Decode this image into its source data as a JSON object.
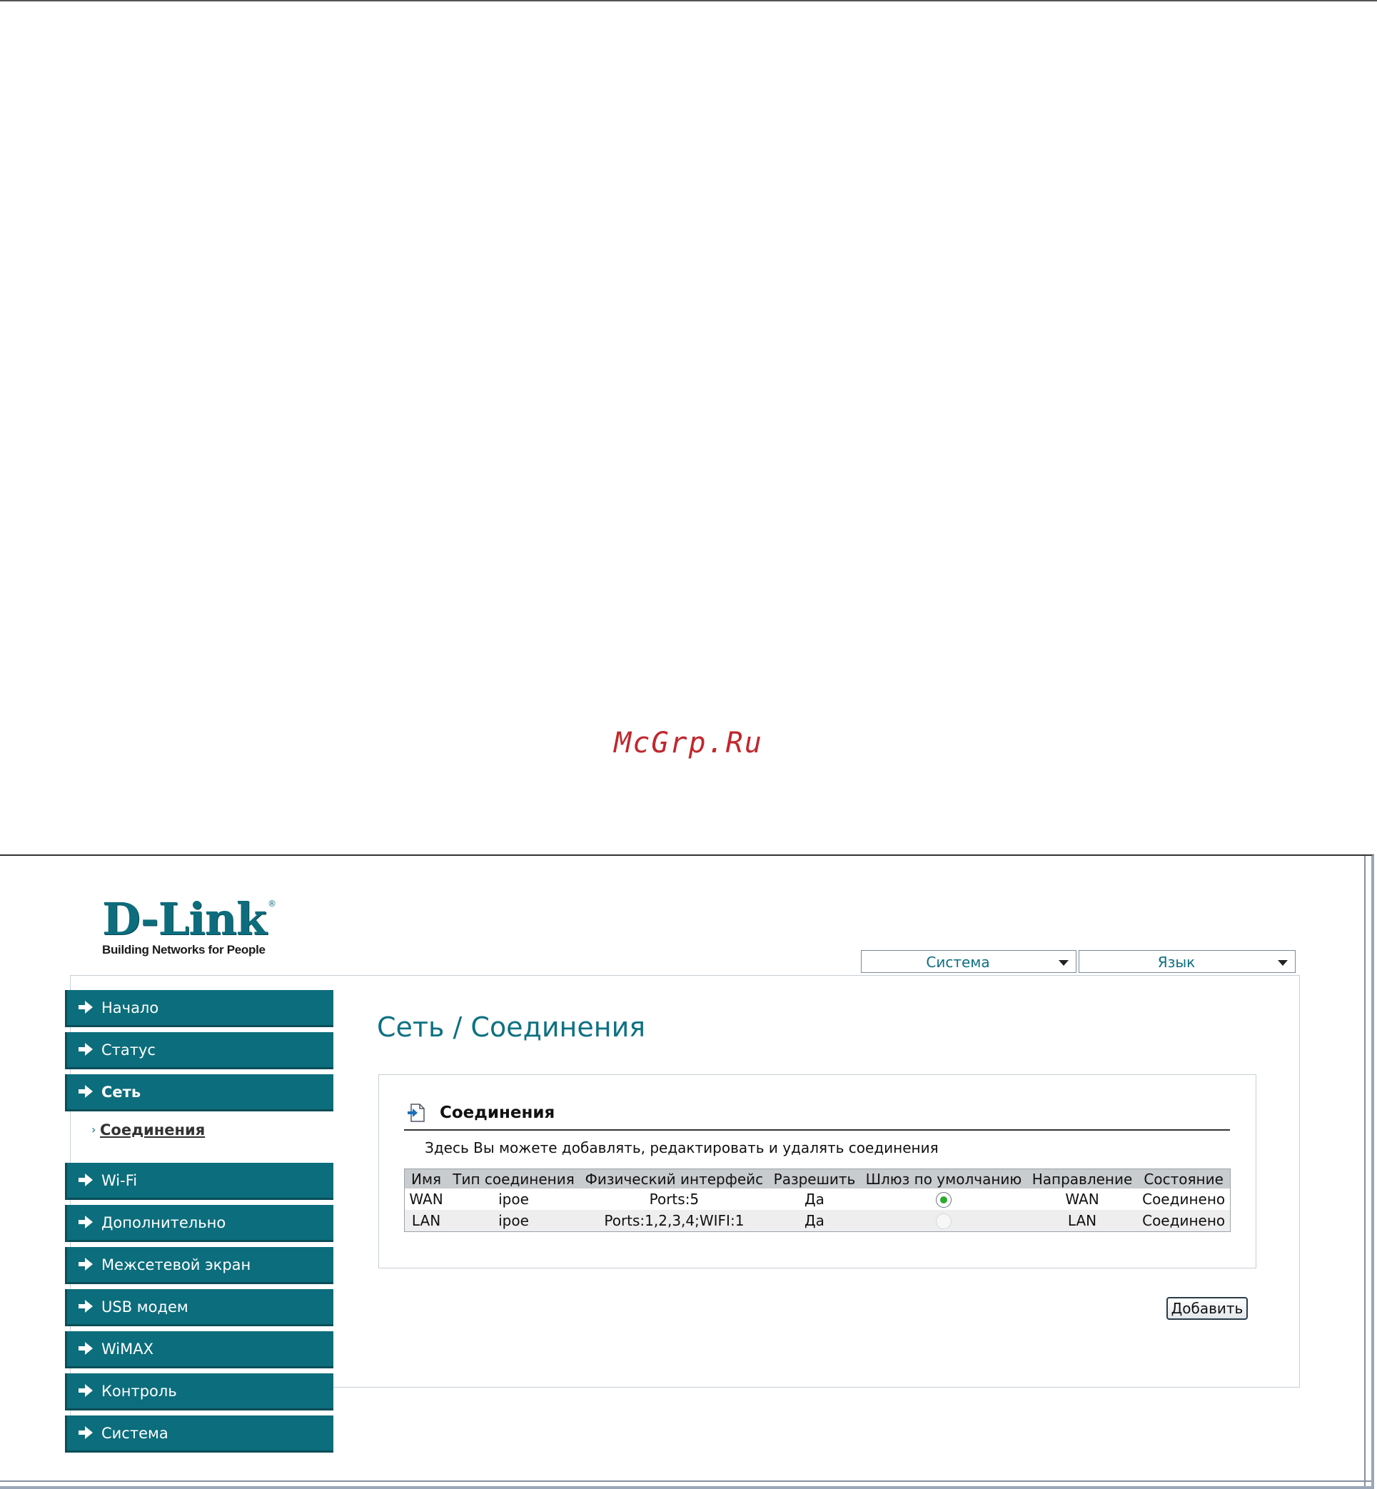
{
  "watermark": "McGrp.Ru",
  "logo": {
    "brand": "D-Link",
    "registered": "®",
    "tagline": "Building Networks for People"
  },
  "top_menus": [
    {
      "label": "Система"
    },
    {
      "label": "Язык"
    }
  ],
  "sidebar": {
    "items": [
      {
        "label": "Начало"
      },
      {
        "label": "Статус"
      },
      {
        "label": "Сеть"
      },
      {
        "label": "Wi-Fi"
      },
      {
        "label": "Дополнительно"
      },
      {
        "label": "Межсетевой экран"
      },
      {
        "label": "USB модем"
      },
      {
        "label": "WiMAX"
      },
      {
        "label": "Контроль"
      },
      {
        "label": "Система"
      }
    ],
    "active": "Сеть",
    "sub_item": {
      "label": "Соединения",
      "bullet": "›"
    }
  },
  "page_title": "Сеть  / Соединения",
  "connections": {
    "title": "Соединения",
    "description": "Здесь Вы можете добавлять, редактировать и удалять соединения",
    "columns": [
      "Имя",
      "Тип соединения",
      "Физический интерфейс",
      "Разрешить",
      "Шлюз по умолчанию",
      "Направление",
      "Состояние"
    ],
    "rows": [
      {
        "name": "WAN",
        "type": "ipoe",
        "iface": "Ports:5",
        "enabled": "Да",
        "default_gateway": true,
        "direction": "WAN",
        "status": "Соединено"
      },
      {
        "name": "LAN",
        "type": "ipoe",
        "iface": "Ports:1,2,3,4;WIFI:1",
        "enabled": "Да",
        "default_gateway": false,
        "direction": "LAN",
        "status": "Соединено"
      }
    ]
  },
  "add_button": {
    "label": "Добавить"
  },
  "colors": {
    "accent": "#0c6d7c",
    "title": "#0e7182",
    "watermark": "#c0282e"
  }
}
